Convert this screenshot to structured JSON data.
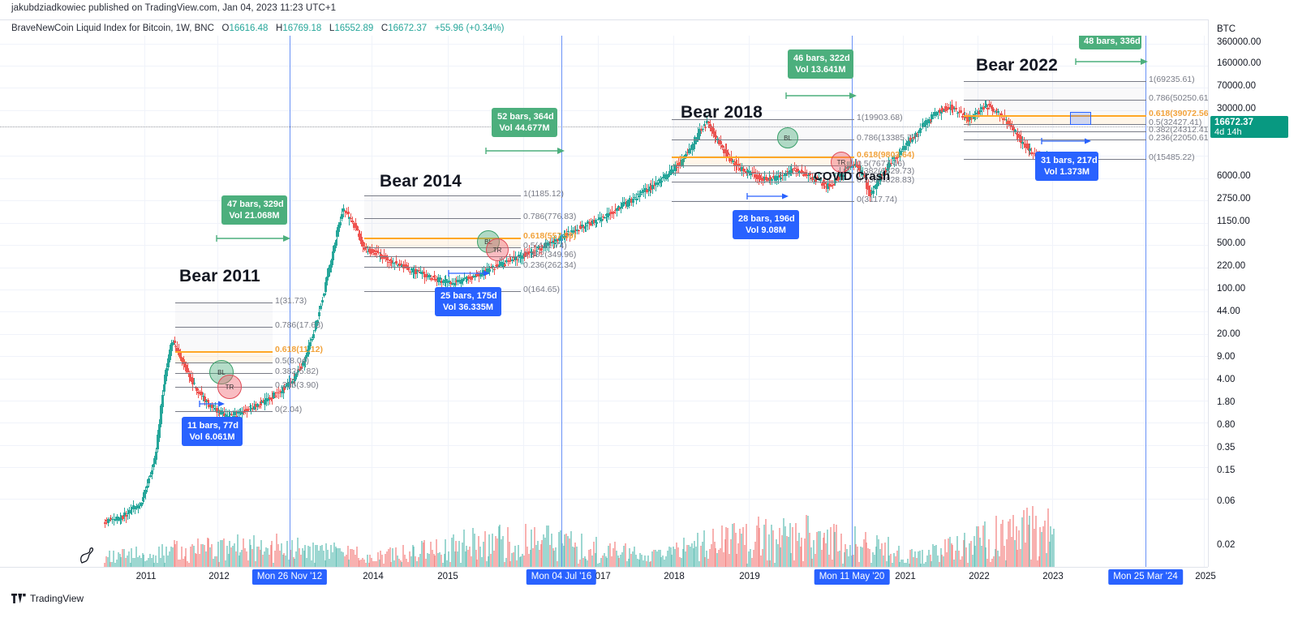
{
  "header": {
    "publisher_line": "jakubdziadkowiec published on TradingView.com, Jan 04, 2023 11:23 UTC+1",
    "symbol": "BraveNewCoin Liquid Index for Bitcoin, 1W, BNC",
    "open_label": "O",
    "open": "16616.48",
    "high_label": "H",
    "high": "16769.18",
    "low_label": "L",
    "low": "16552.89",
    "close_label": "C",
    "close": "16672.37",
    "change": "+55.96 (+0.34%)"
  },
  "price_axis": {
    "unit": "BTC",
    "ticks": [
      "360000.00",
      "160000.00",
      "70000.00",
      "30000.00",
      "6000.00",
      "2750.00",
      "1150.00",
      "500.00",
      "220.00",
      "100.00",
      "44.00",
      "20.00",
      "9.00",
      "4.00",
      "1.80",
      "0.80",
      "0.35",
      "0.15",
      "0.06",
      "0.02"
    ],
    "current_price": "16672.37",
    "countdown": "4d 14h"
  },
  "date_axis": {
    "ticks": [
      "2011",
      "2012",
      "2014",
      "2015",
      "2017",
      "2018",
      "2019",
      "2021",
      "2022",
      "2023",
      "2025"
    ],
    "highlighted": [
      "Mon 26 Nov '12",
      "Mon 04 Jul '16",
      "Mon 11 May '20",
      "Mon 25 Mar '24"
    ]
  },
  "titles": {
    "bear2011": "Bear 2011",
    "bear2014": "Bear 2014",
    "bear2018": "Bear 2018",
    "bear2022": "Bear 2022",
    "covid": "COVID Crash"
  },
  "measurements": {
    "green": [
      {
        "id": "g2011",
        "bars": "47 bars, 329d",
        "vol": "Vol 21.068M"
      },
      {
        "id": "g2014",
        "bars": "52 bars, 364d",
        "vol": "Vol 44.677M"
      },
      {
        "id": "g2018",
        "bars": "46 bars, 322d",
        "vol": "Vol 13.641M"
      },
      {
        "id": "g2022",
        "bars": "48 bars, 336d",
        "vol": ""
      }
    ],
    "blue": [
      {
        "id": "b2011",
        "bars": "11 bars, 77d",
        "vol": "Vol 6.061M"
      },
      {
        "id": "b2014",
        "bars": "25 bars, 175d",
        "vol": "Vol 36.335M"
      },
      {
        "id": "b2018",
        "bars": "28 bars, 196d",
        "vol": "Vol 9.08M"
      },
      {
        "id": "b2022",
        "bars": "31 bars, 217d",
        "vol": "Vol 1.373M"
      }
    ]
  },
  "fib_sets": {
    "bear2011": [
      "1(31.73)",
      "0.786(17.63)",
      "0.618(11.12)",
      "0.5(8.04)",
      "0.382(5.82)",
      "0.236(3.90)",
      "0(2.04)"
    ],
    "bear2014": [
      "1(1185.12)",
      "0.786(776.83)",
      "0.618(557.59)",
      "0.5(441.74)",
      "0.382(349.96)",
      "0.236(262.34)",
      "0(164.65)"
    ],
    "bear2018": [
      "1(19903.68)",
      "0.786(13385.77)",
      "0.618(9803.64)",
      "0.5(7677.46)",
      "0.382(6329.73)",
      "0.236(4828.83)",
      "0(3117.74)"
    ],
    "bear2022": [
      "1(69235.61)",
      "0.786(50250.61)",
      "0.618(39072.56)",
      "0.5(32427.41)",
      "0.382(24312.41)",
      "0.236(22050.61)",
      "0(15485.22)"
    ]
  },
  "circle_labels": {
    "green": "BL",
    "red": "TR"
  },
  "footer": {
    "brand": "TradingView"
  },
  "colors": {
    "green": "#4caf7d",
    "blue": "#2962ff",
    "fib_gold": "#ffa726",
    "price_tag": "#089981",
    "up": "#26a69a",
    "down": "#ef5350"
  }
}
